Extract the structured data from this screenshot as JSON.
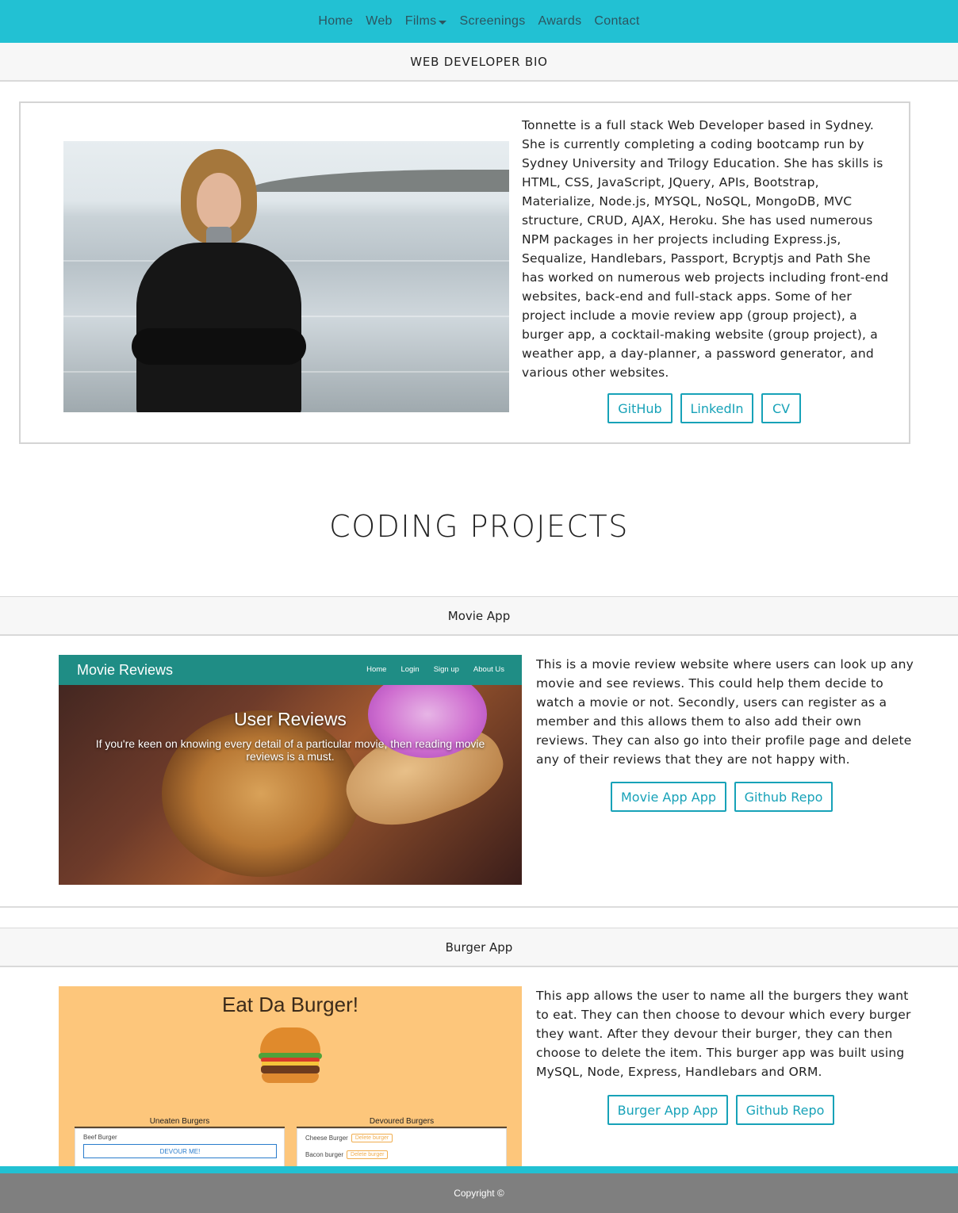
{
  "nav": {
    "items": [
      {
        "label": "Home"
      },
      {
        "label": "Web"
      },
      {
        "label": "Films"
      },
      {
        "label": "Screenings"
      },
      {
        "label": "Awards"
      },
      {
        "label": "Contact"
      }
    ]
  },
  "bio": {
    "header": "WEB DEVELOPER BIO",
    "text": "Tonnette is a full stack Web Developer based in Sydney. She is currently completing a coding bootcamp run by Sydney University and Trilogy Education. She has skills is HTML, CSS, JavaScript, JQuery, APIs, Bootstrap, Materialize, Node.js, MYSQL, NoSQL, MongoDB, MVC structure, CRUD, AJAX, Heroku. She has used numerous NPM packages in her projects including Express.js, Sequalize, Handlebars, Passport, Bcryptjs and Path She has worked on numerous web projects including front-end websites, back-end and full-stack apps. Some of her project include a movie review app (group project), a burger app, a cocktail-making website (group project), a weather app, a day-planner, a password generator, and various other websites.",
    "buttons": {
      "github": "GitHub",
      "linkedin": "LinkedIn",
      "cv": "CV"
    }
  },
  "projects_title": "CODING PROJECTS",
  "projects": [
    {
      "title": "Movie App",
      "description": "This is a movie review website where users can look up any movie and see reviews. This could help them decide to watch a movie or not. Secondly, users can register as a member and this allows them to also add their own reviews. They can also go into their profile page and delete any of their reviews that they are not happy with.",
      "app_button": "Movie App App",
      "repo_button": "Github Repo",
      "screenshot": {
        "brand": "Movie Reviews",
        "links": [
          "Home",
          "Login",
          "Sign up",
          "About Us"
        ],
        "hero_title": "User Reviews",
        "hero_sub": "If you're keen on knowing every detail of a particular movie, then reading movie reviews is a must."
      }
    },
    {
      "title": "Burger App",
      "description": "This app allows the user to name all the burgers they want to eat. They can then choose to devour which every burger they want. After they devour their burger, they can then choose to delete the item. This burger app was built using MySQL, Node, Express, Handlebars and ORM.",
      "app_button": "Burger App App",
      "repo_button": "Github Repo",
      "screenshot": {
        "title": "Eat Da Burger!",
        "uneaten_title": "Uneaten Burgers",
        "devoured_title": "Devoured Burgers",
        "uneaten_item": "Beef Burger",
        "devour_label": "DEVOUR ME!",
        "devoured_items": [
          "Cheese Burger",
          "Bacon burger"
        ],
        "delete_label": "Delete burger"
      }
    }
  ],
  "footer": {
    "text": "Copyright ©"
  },
  "colors": {
    "accent": "#22c1d3",
    "button": "#17a2b8",
    "footer": "#7f7f7f"
  }
}
